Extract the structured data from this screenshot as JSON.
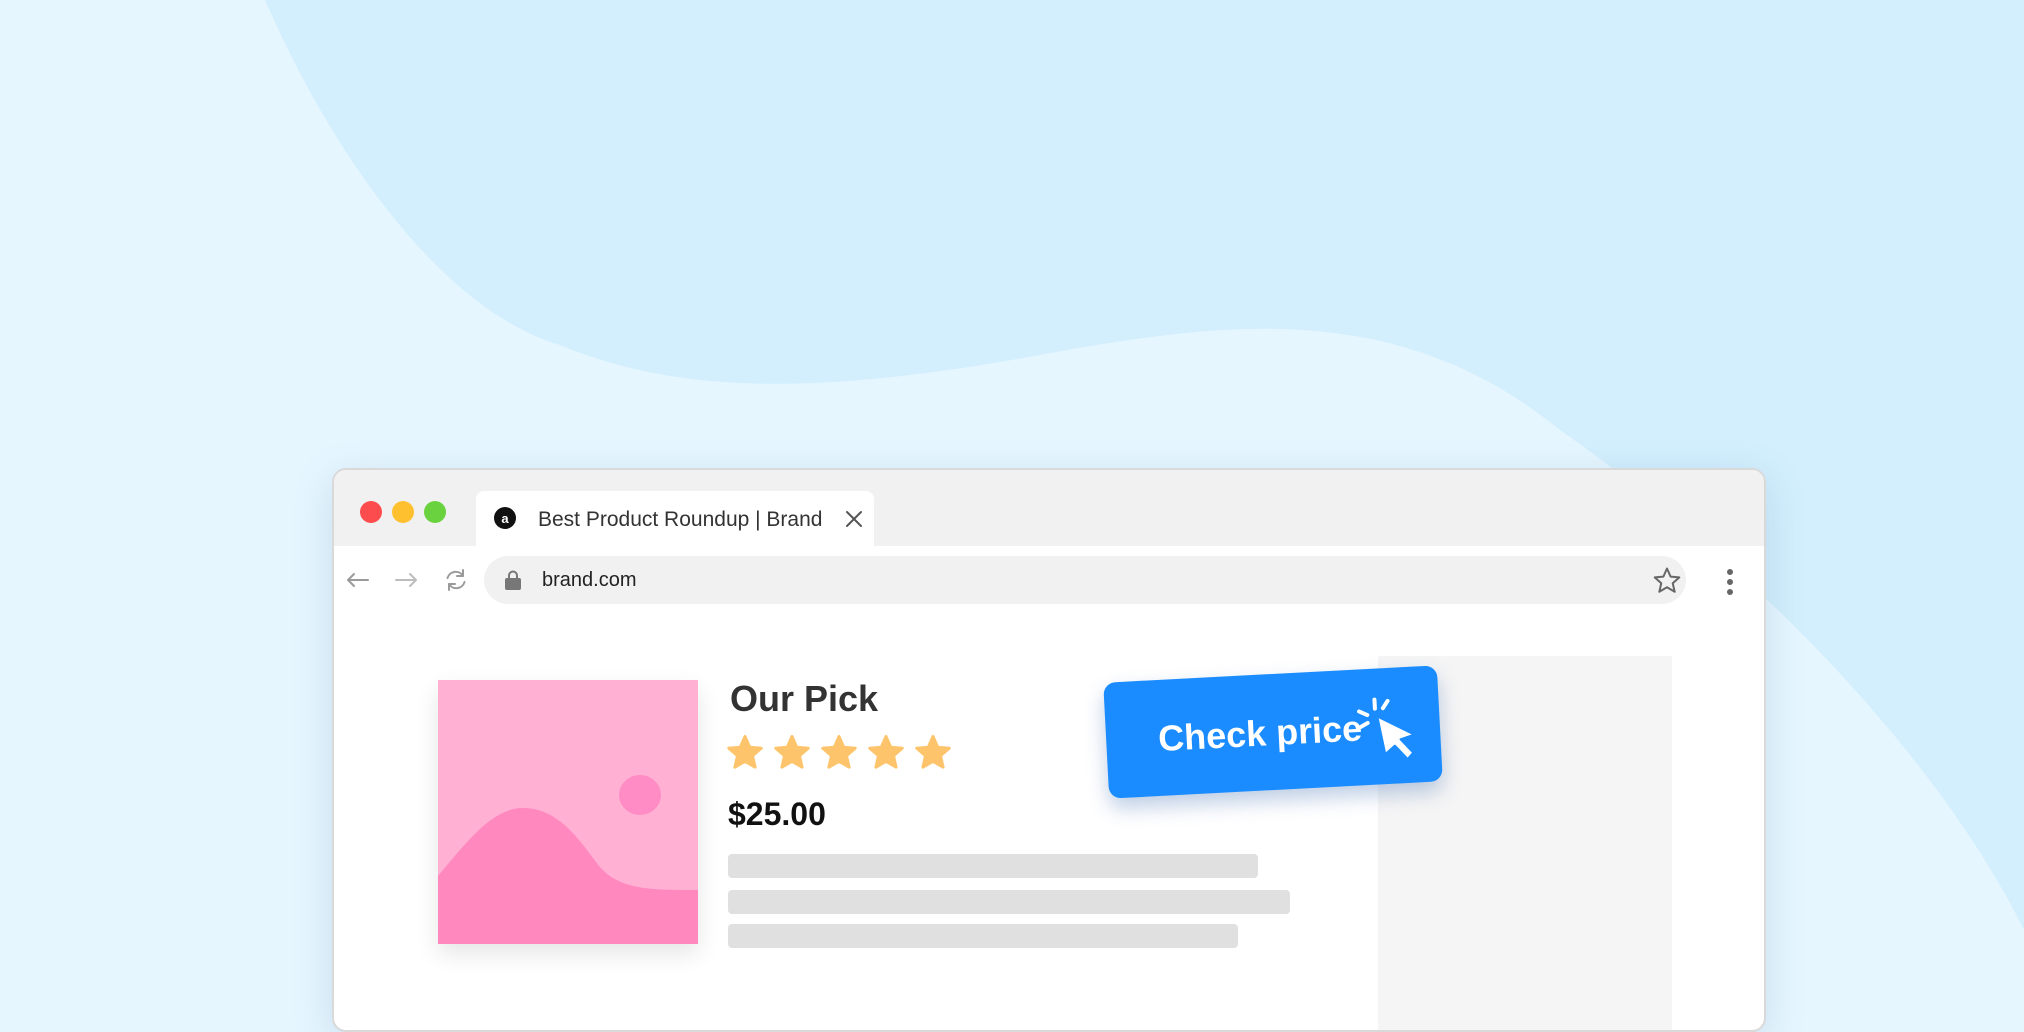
{
  "colors": {
    "background": "#e6f6ff",
    "background_wave": "#d3effd",
    "accent": "#1a8cff",
    "star": "#fec46c",
    "image_pink": "#ffb0d3",
    "image_hill": "#ff88bf"
  },
  "browser": {
    "tab": {
      "favicon_letter": "a",
      "title": "Best Product Roundup | Brand"
    },
    "address_bar": {
      "url": "brand.com"
    }
  },
  "product": {
    "title": "Our Pick",
    "rating": 5,
    "rating_max": 5,
    "price": "$25.00"
  },
  "cta": {
    "label": "Check price"
  },
  "icons": {
    "back": "arrow-left-icon",
    "forward": "arrow-right-icon",
    "reload": "reload-icon",
    "lock": "lock-icon",
    "bookmark": "star-outline-icon",
    "menu": "vertical-dots-icon",
    "close": "close-icon",
    "cursor": "click-cursor-icon"
  }
}
